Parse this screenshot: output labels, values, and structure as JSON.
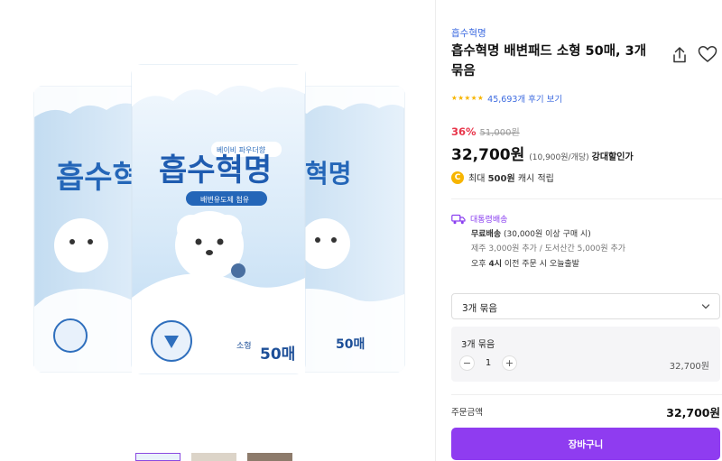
{
  "product": {
    "brand": "흡수혁명",
    "title": "흡수혁명 배변패드 소형 50매, 3개 묶음",
    "rating_stars": 5,
    "review_text": "45,693개 후기 보기",
    "discount": "36%",
    "original_price": "51,000원",
    "price": "32,700원",
    "unit_price": "(10,900원/개당)",
    "sale_tag": "강대할인가",
    "cash_prefix": "최대",
    "cash_amount": "500원",
    "cash_suffix": "캐시 적립",
    "coin_symbol": "C"
  },
  "package": {
    "brand_logo": "흡수혁명",
    "badge_text": "베이비 파우더향",
    "sub_text": "배변유도제 첨유",
    "size_text": "소형",
    "count_text": "50매"
  },
  "shipping": {
    "type": "대통령배송",
    "free_label": "무료배송",
    "free_condition": "(30,000원 이상 구매 시)",
    "extra_fee": "제주 3,000원 추가 / 도서산간 5,000원 추가",
    "dispatch_prefix": "오후",
    "dispatch_time": "4시",
    "dispatch_suffix": "이전 주문 시 오늘출발"
  },
  "option": {
    "selected": "3개 묶음",
    "item_name": "3개 묶음",
    "minus": "−",
    "quantity": "1",
    "plus": "+",
    "item_price": "32,700원"
  },
  "order": {
    "total_label": "주문금액",
    "total_price": "32,700원",
    "cart_button": "장바구니"
  },
  "colors": {
    "accent": "#8f3cf0",
    "link": "#3d6be0",
    "discount": "#e8364b",
    "star": "#f7b500"
  },
  "icons": [
    "share-icon",
    "heart-icon",
    "star-icon",
    "coin-icon",
    "truck-icon",
    "chevron-down-icon"
  ]
}
